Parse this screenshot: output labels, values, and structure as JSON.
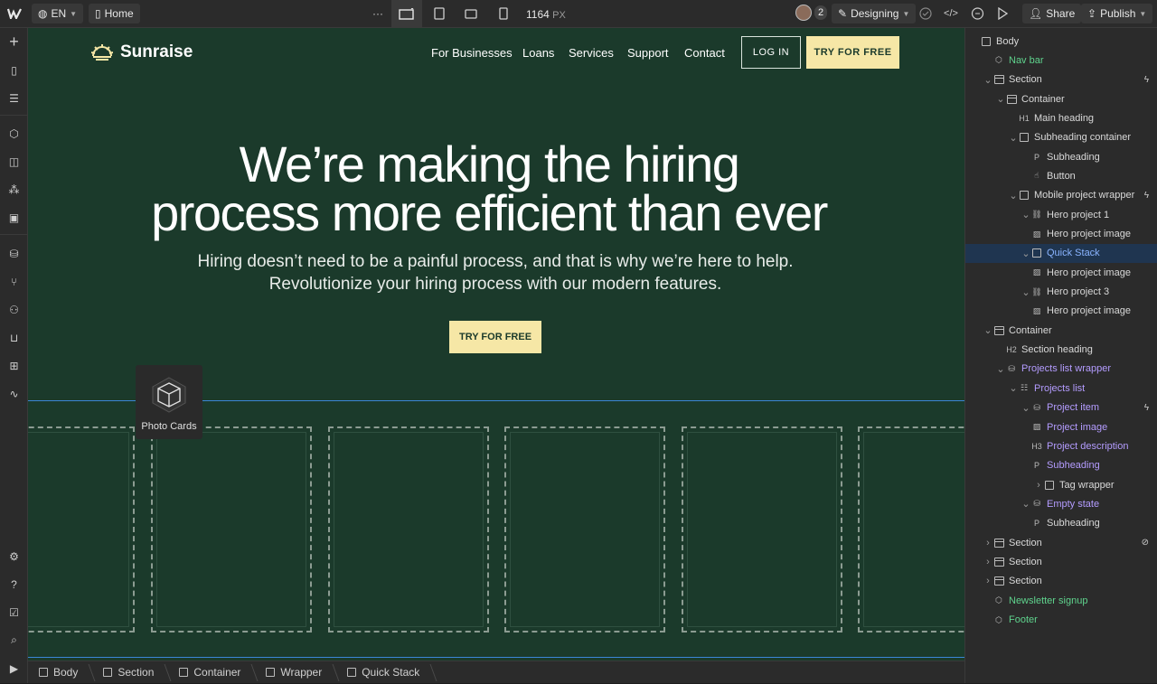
{
  "topbar": {
    "lang": "EN",
    "page": "Home",
    "more": "···",
    "width_value": "1164",
    "width_unit": "PX",
    "collaborator_count": "2",
    "mode": "Designing",
    "share": "Share",
    "publish": "Publish"
  },
  "site": {
    "logo_text": "Sunraise",
    "nav": [
      "For Businesses",
      "Loans",
      "Services",
      "Support",
      "Contact"
    ],
    "login": "LOG IN",
    "try_free": "TRY FOR FREE",
    "hero_line1": "We’re making the hiring",
    "hero_line2": "process more efficient than ever",
    "sub_line1": "Hiring doesn’t need to be a painful process, and that is why we’re here to help.",
    "sub_line2": "Revolutionize your hiring process with our modern features.",
    "hero_button": "TRY FOR FREE",
    "tooltip_label": "Photo Cards"
  },
  "breadcrumbs": [
    "Body",
    "Section",
    "Container",
    "Wrapper",
    "Quick Stack"
  ],
  "navigator": [
    {
      "label": "Body",
      "indent": 0,
      "chev": "",
      "icon": "box",
      "color": "normal"
    },
    {
      "label": "Nav bar",
      "indent": 1,
      "chev": "",
      "icon": "component",
      "color": "green"
    },
    {
      "label": "Section",
      "indent": 1,
      "chev": "v",
      "icon": "section",
      "color": "normal",
      "bolt": true
    },
    {
      "label": "Container",
      "indent": 2,
      "chev": "v",
      "icon": "section",
      "color": "normal"
    },
    {
      "label": "Main heading",
      "indent": 3,
      "chev": "",
      "icon": "H1",
      "color": "normal"
    },
    {
      "label": "Subheading container",
      "indent": 3,
      "chev": "v",
      "icon": "box",
      "color": "normal"
    },
    {
      "label": "Subheading",
      "indent": 4,
      "chev": "",
      "icon": "P",
      "color": "normal"
    },
    {
      "label": "Button",
      "indent": 4,
      "chev": "",
      "icon": "hand",
      "color": "normal"
    },
    {
      "label": "Mobile project wrapper",
      "indent": 3,
      "chev": "v",
      "icon": "box",
      "color": "normal",
      "bolt": true
    },
    {
      "label": "Hero project 1",
      "indent": 4,
      "chev": "v",
      "icon": "link",
      "color": "normal"
    },
    {
      "label": "Hero project image",
      "indent": 4,
      "chev": "",
      "icon": "image",
      "color": "normal"
    },
    {
      "label": "Quick Stack",
      "indent": 4,
      "chev": "v",
      "icon": "box",
      "color": "normal",
      "selected": true
    },
    {
      "label": "Hero project image",
      "indent": 4,
      "chev": "",
      "icon": "image",
      "color": "normal"
    },
    {
      "label": "Hero project 3",
      "indent": 4,
      "chev": "v",
      "icon": "link",
      "color": "normal"
    },
    {
      "label": "Hero project image",
      "indent": 4,
      "chev": "",
      "icon": "image",
      "color": "normal"
    },
    {
      "label": "Container",
      "indent": 1,
      "chev": "v",
      "icon": "section",
      "color": "normal"
    },
    {
      "label": "Section heading",
      "indent": 2,
      "chev": "",
      "icon": "H2",
      "color": "normal"
    },
    {
      "label": "Projects list wrapper",
      "indent": 2,
      "chev": "v",
      "icon": "db",
      "color": "purple"
    },
    {
      "label": "Projects list",
      "indent": 3,
      "chev": "v",
      "icon": "list",
      "color": "purple"
    },
    {
      "label": "Project item",
      "indent": 4,
      "chev": "v",
      "icon": "db",
      "color": "purple",
      "bolt": true
    },
    {
      "label": "Project image",
      "indent": 4,
      "chev": "",
      "icon": "image",
      "color": "purple"
    },
    {
      "label": "Project description",
      "indent": 4,
      "chev": "",
      "icon": "H3",
      "color": "purple"
    },
    {
      "label": "Subheading",
      "indent": 4,
      "chev": "",
      "icon": "P",
      "color": "purple"
    },
    {
      "label": "Tag wrapper",
      "indent": 5,
      "chev": ">",
      "icon": "box",
      "color": "normal"
    },
    {
      "label": "Empty state",
      "indent": 4,
      "chev": "v",
      "icon": "db",
      "color": "purple"
    },
    {
      "label": "Subheading",
      "indent": 4,
      "chev": "",
      "icon": "P",
      "color": "normal"
    },
    {
      "label": "Section",
      "indent": 1,
      "chev": ">",
      "icon": "section",
      "color": "normal",
      "hidden": true
    },
    {
      "label": "Section",
      "indent": 1,
      "chev": ">",
      "icon": "section",
      "color": "normal"
    },
    {
      "label": "Section",
      "indent": 1,
      "chev": ">",
      "icon": "section",
      "color": "normal"
    },
    {
      "label": "Newsletter signup",
      "indent": 1,
      "chev": "",
      "icon": "component",
      "color": "green"
    },
    {
      "label": "Footer",
      "indent": 1,
      "chev": "",
      "icon": "component",
      "color": "green"
    }
  ],
  "colors": {
    "canvas_bg": "#1b3a2b",
    "accent_yellow": "#f6e7a6",
    "selection_blue": "#3b86d6"
  }
}
